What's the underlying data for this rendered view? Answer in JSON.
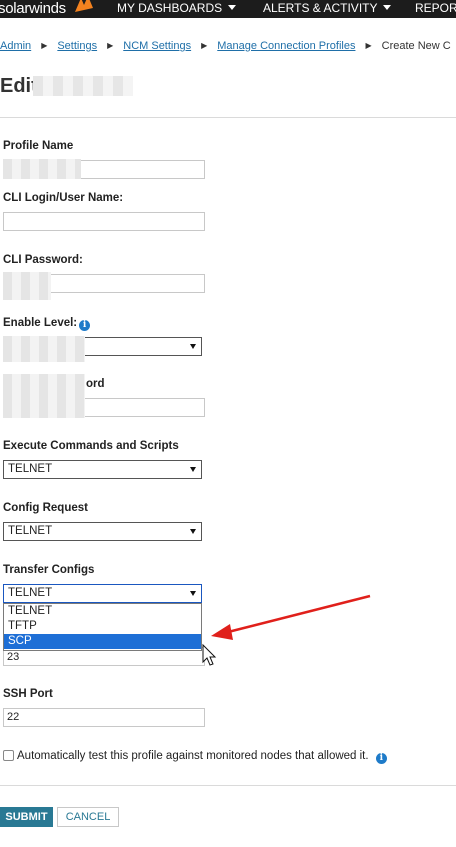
{
  "topnav": {
    "logo": "solarwinds",
    "items": [
      {
        "label": "MY DASHBOARDS"
      },
      {
        "label": "ALERTS & ACTIVITY"
      },
      {
        "label": "REPORT"
      }
    ]
  },
  "breadcrumb": [
    "Admin",
    "Settings",
    "NCM Settings",
    "Manage Connection Profiles",
    "Create New C"
  ],
  "page": {
    "title": "Edit"
  },
  "form": {
    "profile_name": {
      "label": "Profile Name"
    },
    "cli_login": {
      "label": "CLI Login/User Name:"
    },
    "cli_password": {
      "label": "CLI Password:"
    },
    "enable_level": {
      "label": "Enable Level:"
    },
    "enable_password": {
      "label_visible": "ord"
    },
    "execute_commands": {
      "label": "Execute Commands and Scripts",
      "value": "TELNET"
    },
    "config_request": {
      "label": "Config Request",
      "value": "TELNET"
    },
    "transfer_configs": {
      "label": "Transfer Configs",
      "value": "TELNET",
      "options": [
        "TELNET",
        "TFTP",
        "SCP"
      ],
      "highlighted": "SCP"
    },
    "telnet_port": {
      "value": "23"
    },
    "ssh_port": {
      "label": "SSH Port",
      "value": "22"
    },
    "auto_test": {
      "label": "Automatically test this profile against monitored nodes that allowed it."
    }
  },
  "buttons": {
    "submit": "SUBMIT",
    "cancel": "CANCEL"
  },
  "colors": {
    "nav_bg": "#1c1c1c",
    "link": "#1f6fa8",
    "submit_bg": "#297994",
    "selection": "#1e6fd6",
    "annotation_arrow": "#e0201b"
  },
  "icons": {
    "info": "info-icon",
    "dropdown": "chevron-down-icon",
    "cursor": "mouse-pointer-icon",
    "annotation": "red-arrow-icon"
  }
}
